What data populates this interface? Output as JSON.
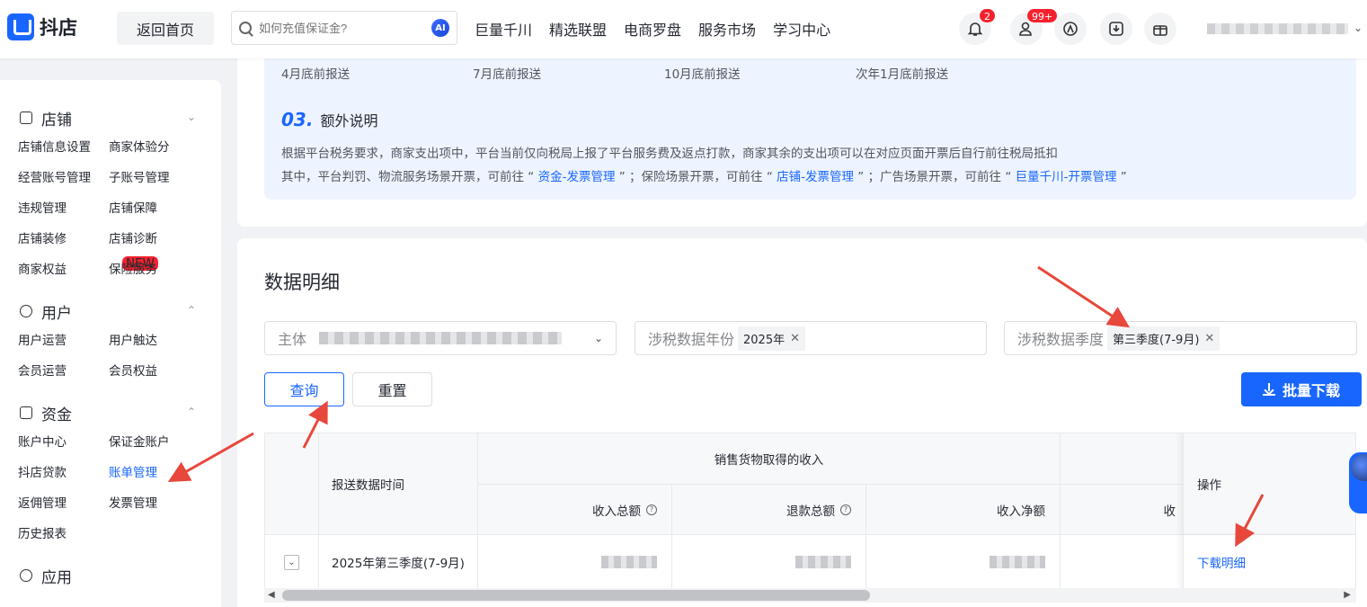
{
  "header": {
    "logo_text": "抖店",
    "home_button": "返回首页",
    "search_placeholder": "如何充值保证金?",
    "ai_label": "AI",
    "nav": [
      "巨量千川",
      "精选联盟",
      "电商罗盘",
      "服务市场",
      "学习中心"
    ],
    "notification_count": "2",
    "message_count": "99+"
  },
  "sidebar": {
    "groups": [
      {
        "title": "店铺",
        "items": [
          "店铺信息设置",
          "商家体验分",
          "经营账号管理",
          "子账号管理",
          "违规管理",
          "店铺保障",
          "店铺装修",
          "店铺诊断",
          "商家权益",
          "保险服务"
        ],
        "new_tag": "NEW"
      },
      {
        "title": "用户",
        "items": [
          "用户运营",
          "用户触达",
          "会员运营",
          "会员权益"
        ]
      },
      {
        "title": "资金",
        "items": [
          "账户中心",
          "保证金账户",
          "抖店贷款",
          "账单管理",
          "返佣管理",
          "发票管理",
          "历史报表"
        ],
        "active": "账单管理"
      },
      {
        "title": "应用"
      }
    ]
  },
  "info": {
    "deadlines": [
      "4月底前报送",
      "7月底前报送",
      "10月底前报送",
      "次年1月底前报送"
    ],
    "extra_num": "03.",
    "extra_title": "额外说明",
    "note1": "根据平台税务要求，商家支出项中，平台当前仅向税局上报了平台服务费及返点打款，商家其余的支出项可以在对应页面开票后自行前往税局抵扣",
    "note2_a": "其中，平台判罚、物流服务场景开票，可前往 “ ",
    "note2_link1": "资金-发票管理",
    "note2_b": " ” ；保险场景开票，可前往 “ ",
    "note2_link2": "店铺-发票管理",
    "note2_c": " ” ；广告场景开票，可前往 “ ",
    "note2_link3": "巨量千川-开票管理",
    "note2_d": " ”"
  },
  "detail": {
    "title": "数据明细",
    "filter_subject_label": "主体",
    "filter_year_label": "涉税数据年份",
    "filter_year_value": "2025年",
    "filter_quarter_label": "涉税数据季度",
    "filter_quarter_value": "第三季度(7-9月)",
    "query_button": "查询",
    "reset_button": "重置",
    "download_button": "批量下载"
  },
  "table": {
    "col_time": "报送数据时间",
    "group_header": "销售货物取得的收入",
    "col_income_total": "收入总额",
    "col_refund_total": "退款总额",
    "col_income_net": "收入净额",
    "col_partial": "收",
    "col_action": "操作",
    "rows": [
      {
        "time": "2025年第三季度(7-9月)",
        "action": "下载明细"
      }
    ]
  },
  "colors": {
    "primary": "#1966ff",
    "annotation_arrow": "#e8473b"
  }
}
